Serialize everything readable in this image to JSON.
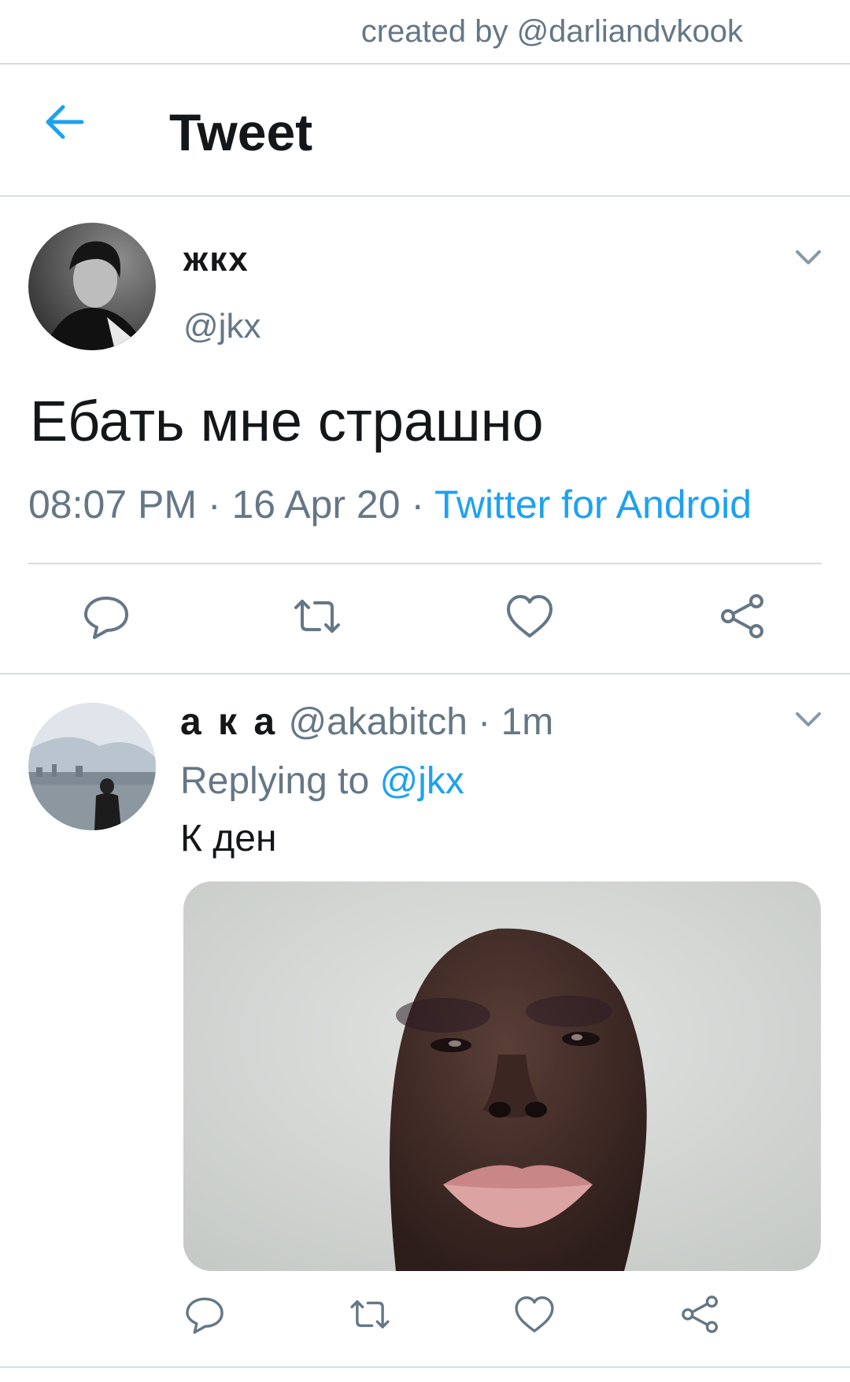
{
  "watermark": "created by @darliandvkook",
  "header": {
    "title": "Tweet",
    "back_icon": "arrow-left-icon"
  },
  "tweet": {
    "name": "жкх",
    "handle": "@jkx",
    "text": "Ебать мне страшно",
    "time": "08:07 PM",
    "date": "16 Apr 20",
    "source": "Twitter for Android",
    "sep": " · ",
    "actions": [
      "reply-icon",
      "retweet-icon",
      "like-icon",
      "share-icon"
    ]
  },
  "reply": {
    "name": "а к а",
    "handle": "@akabitch",
    "time": "1m",
    "replying_label": "Replying to",
    "replying_handle": "@jkx",
    "text": "К ден",
    "actions": [
      "reply-icon",
      "retweet-icon",
      "like-icon",
      "share-icon"
    ]
  },
  "colors": {
    "accent": "#1da1f2",
    "secondary_text": "#657786",
    "divider": "#d6dde3"
  }
}
